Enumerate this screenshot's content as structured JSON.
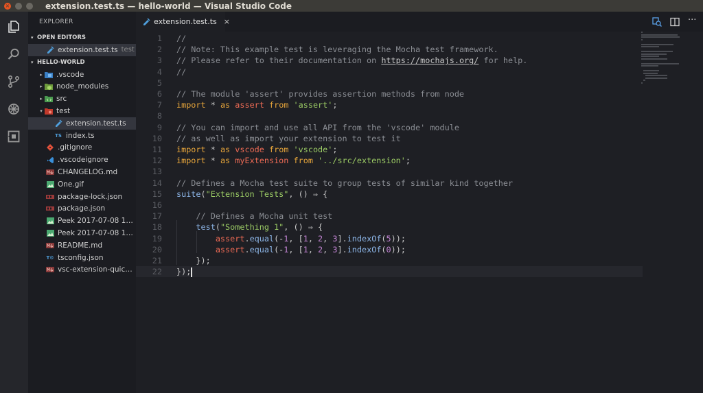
{
  "window": {
    "title": "extension.test.ts — hello-world — Visual Studio Code"
  },
  "activity_bar": {
    "items": [
      {
        "name": "explorer",
        "icon": "files-icon"
      },
      {
        "name": "search",
        "icon": "search-icon"
      },
      {
        "name": "source-control",
        "icon": "git-branch-icon"
      },
      {
        "name": "debug",
        "icon": "debug-icon"
      },
      {
        "name": "extensions",
        "icon": "extensions-icon"
      }
    ]
  },
  "sidebar": {
    "title": "EXPLORER",
    "open_editors": {
      "label": "OPEN EDITORS",
      "items": [
        {
          "label": "extension.test.ts",
          "desc": "test"
        }
      ]
    },
    "workspace": {
      "label": "HELLO-WORLD",
      "items": [
        {
          "label": ".vscode",
          "type": "folder",
          "expanded": false
        },
        {
          "label": "node_modules",
          "type": "folder",
          "expanded": false
        },
        {
          "label": "src",
          "type": "folder",
          "expanded": false
        },
        {
          "label": "test",
          "type": "folder",
          "expanded": true
        },
        {
          "label": "extension.test.ts",
          "type": "ts",
          "active": true
        },
        {
          "label": "index.ts",
          "type": "ts-file"
        },
        {
          "label": ".gitignore",
          "type": "git"
        },
        {
          "label": ".vscodeignore",
          "type": "vscode"
        },
        {
          "label": "CHANGELOG.md",
          "type": "md"
        },
        {
          "label": "One.gif",
          "type": "image"
        },
        {
          "label": "package-lock.json",
          "type": "json"
        },
        {
          "label": "package.json",
          "type": "json"
        },
        {
          "label": "Peek 2017-07-08 18-2...",
          "type": "image"
        },
        {
          "label": "Peek 2017-07-08 18-2...",
          "type": "image"
        },
        {
          "label": "README.md",
          "type": "md"
        },
        {
          "label": "tsconfig.json",
          "type": "tsconfig"
        },
        {
          "label": "vsc-extension-quickst...",
          "type": "md"
        }
      ]
    }
  },
  "tabs": [
    {
      "label": "extension.test.ts",
      "close": "×"
    }
  ],
  "editor": {
    "lines": [
      {
        "n": "1",
        "tokens": [
          [
            "c-comment",
            "//"
          ]
        ]
      },
      {
        "n": "2",
        "tokens": [
          [
            "c-comment",
            "// Note: This example test is leveraging the Mocha test framework."
          ]
        ]
      },
      {
        "n": "3",
        "tokens": [
          [
            "c-comment",
            "// Please refer to their documentation on "
          ],
          [
            "c-link",
            "https://mochajs.org/"
          ],
          [
            "c-comment",
            " for help."
          ]
        ]
      },
      {
        "n": "4",
        "tokens": [
          [
            "c-comment",
            "//"
          ]
        ]
      },
      {
        "n": "5",
        "tokens": []
      },
      {
        "n": "6",
        "tokens": [
          [
            "c-comment",
            "// The module 'assert' provides assertion methods from node"
          ]
        ]
      },
      {
        "n": "7",
        "tokens": [
          [
            "c-kw",
            "import"
          ],
          [
            "c-op",
            " * "
          ],
          [
            "c-kw",
            "as"
          ],
          [
            "c-op",
            " "
          ],
          [
            "c-var",
            "assert"
          ],
          [
            "c-op",
            " "
          ],
          [
            "c-kw",
            "from"
          ],
          [
            "c-op",
            " "
          ],
          [
            "c-str",
            "'assert'"
          ],
          [
            "c-op",
            ";"
          ]
        ]
      },
      {
        "n": "8",
        "tokens": []
      },
      {
        "n": "9",
        "tokens": [
          [
            "c-comment",
            "// You can import and use all API from the 'vscode' module"
          ]
        ]
      },
      {
        "n": "10",
        "tokens": [
          [
            "c-comment",
            "// as well as import your extension to test it"
          ]
        ]
      },
      {
        "n": "11",
        "tokens": [
          [
            "c-kw",
            "import"
          ],
          [
            "c-op",
            " * "
          ],
          [
            "c-kw",
            "as"
          ],
          [
            "c-op",
            " "
          ],
          [
            "c-var",
            "vscode"
          ],
          [
            "c-op",
            " "
          ],
          [
            "c-kw",
            "from"
          ],
          [
            "c-op",
            " "
          ],
          [
            "c-str",
            "'vscode'"
          ],
          [
            "c-op",
            ";"
          ]
        ]
      },
      {
        "n": "12",
        "tokens": [
          [
            "c-kw",
            "import"
          ],
          [
            "c-op",
            " * "
          ],
          [
            "c-kw",
            "as"
          ],
          [
            "c-op",
            " "
          ],
          [
            "c-var",
            "myExtension"
          ],
          [
            "c-op",
            " "
          ],
          [
            "c-kw",
            "from"
          ],
          [
            "c-op",
            " "
          ],
          [
            "c-str",
            "'../src/extension'"
          ],
          [
            "c-op",
            ";"
          ]
        ]
      },
      {
        "n": "13",
        "tokens": []
      },
      {
        "n": "14",
        "tokens": [
          [
            "c-comment",
            "// Defines a Mocha test suite to group tests of similar kind together"
          ]
        ]
      },
      {
        "n": "15",
        "tokens": [
          [
            "c-fn",
            "suite"
          ],
          [
            "c-op",
            "("
          ],
          [
            "c-str",
            "\"Extension Tests\""
          ],
          [
            "c-op",
            ", () ⇒ {"
          ]
        ]
      },
      {
        "n": "16",
        "tokens": []
      },
      {
        "n": "17",
        "tokens": [
          [
            "c-op",
            "    "
          ],
          [
            "c-comment",
            "// Defines a Mocha unit test"
          ]
        ]
      },
      {
        "n": "18",
        "tokens": [
          [
            "c-op",
            "    "
          ],
          [
            "c-fn",
            "test"
          ],
          [
            "c-op",
            "("
          ],
          [
            "c-str",
            "\"Something 1\""
          ],
          [
            "c-op",
            ", () ⇒ {"
          ]
        ]
      },
      {
        "n": "19",
        "tokens": [
          [
            "c-op",
            "        "
          ],
          [
            "c-var",
            "assert"
          ],
          [
            "c-op",
            "."
          ],
          [
            "c-fn",
            "equal"
          ],
          [
            "c-op",
            "(-"
          ],
          [
            "c-num",
            "1"
          ],
          [
            "c-op",
            ", ["
          ],
          [
            "c-num",
            "1"
          ],
          [
            "c-op",
            ", "
          ],
          [
            "c-num",
            "2"
          ],
          [
            "c-op",
            ", "
          ],
          [
            "c-num",
            "3"
          ],
          [
            "c-op",
            "]."
          ],
          [
            "c-fn",
            "indexOf"
          ],
          [
            "c-op",
            "("
          ],
          [
            "c-num",
            "5"
          ],
          [
            "c-op",
            "));"
          ]
        ]
      },
      {
        "n": "20",
        "tokens": [
          [
            "c-op",
            "        "
          ],
          [
            "c-var",
            "assert"
          ],
          [
            "c-op",
            "."
          ],
          [
            "c-fn",
            "equal"
          ],
          [
            "c-op",
            "(-"
          ],
          [
            "c-num",
            "1"
          ],
          [
            "c-op",
            ", ["
          ],
          [
            "c-num",
            "1"
          ],
          [
            "c-op",
            ", "
          ],
          [
            "c-num",
            "2"
          ],
          [
            "c-op",
            ", "
          ],
          [
            "c-num",
            "3"
          ],
          [
            "c-op",
            "]."
          ],
          [
            "c-fn",
            "indexOf"
          ],
          [
            "c-op",
            "("
          ],
          [
            "c-num",
            "0"
          ],
          [
            "c-op",
            "));"
          ]
        ]
      },
      {
        "n": "21",
        "tokens": [
          [
            "c-op",
            "    });"
          ]
        ]
      },
      {
        "n": "22",
        "tokens": [
          [
            "c-op",
            "});"
          ]
        ]
      }
    ],
    "current_line": 22
  },
  "colors": {
    "accent": "#e95420",
    "ts_blue": "#4f9fdc",
    "git_red": "#e0513b",
    "image_green": "#5fb87a",
    "json_orange": "#e0a050",
    "md_red": "#c85a5a"
  }
}
